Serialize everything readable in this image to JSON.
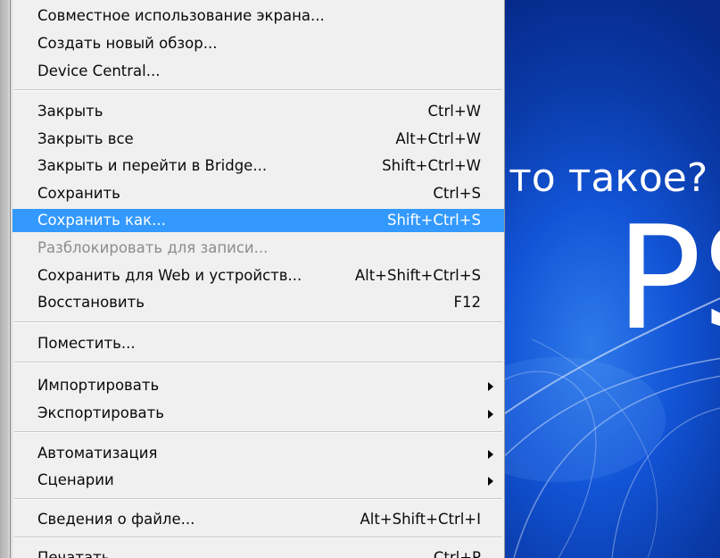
{
  "menu": {
    "items": [
      {
        "label": "Совместное использование экрана...",
        "shortcut": "",
        "submenu": false,
        "state": "normal"
      },
      {
        "label": "Создать новый обзор...",
        "shortcut": "",
        "submenu": false,
        "state": "normal"
      },
      {
        "label": "Device Central...",
        "shortcut": "",
        "submenu": false,
        "state": "normal"
      },
      {
        "label": "Закрыть",
        "shortcut": "Ctrl+W",
        "submenu": false,
        "state": "normal"
      },
      {
        "label": "Закрыть все",
        "shortcut": "Alt+Ctrl+W",
        "submenu": false,
        "state": "normal"
      },
      {
        "label": "Закрыть и перейти в Bridge...",
        "shortcut": "Shift+Ctrl+W",
        "submenu": false,
        "state": "normal"
      },
      {
        "label": "Сохранить",
        "shortcut": "Ctrl+S",
        "submenu": false,
        "state": "normal"
      },
      {
        "label": "Сохранить как...",
        "shortcut": "Shift+Ctrl+S",
        "submenu": false,
        "state": "highlighted"
      },
      {
        "label": "Разблокировать для записи...",
        "shortcut": "",
        "submenu": false,
        "state": "disabled"
      },
      {
        "label": "Сохранить для Web и устройств...",
        "shortcut": "Alt+Shift+Ctrl+S",
        "submenu": false,
        "state": "normal"
      },
      {
        "label": "Восстановить",
        "shortcut": "F12",
        "submenu": false,
        "state": "normal"
      },
      {
        "label": "Поместить...",
        "shortcut": "",
        "submenu": false,
        "state": "normal"
      },
      {
        "label": "Импортировать",
        "shortcut": "",
        "submenu": true,
        "state": "normal"
      },
      {
        "label": "Экспортировать",
        "shortcut": "",
        "submenu": true,
        "state": "normal"
      },
      {
        "label": "Автоматизация",
        "shortcut": "",
        "submenu": true,
        "state": "normal"
      },
      {
        "label": "Сценарии",
        "shortcut": "",
        "submenu": true,
        "state": "normal"
      },
      {
        "label": "Сведения о файле...",
        "shortcut": "Alt+Shift+Ctrl+I",
        "submenu": false,
        "state": "normal"
      },
      {
        "label": "Печатать...",
        "shortcut": "Ctrl+P",
        "submenu": false,
        "state": "normal"
      }
    ]
  },
  "canvas": {
    "question_text": "Что такое?",
    "logo_text": "PS",
    "colors": {
      "background": "#0a3aa8",
      "glow": "#2e7bea",
      "text": "#ffffff"
    }
  },
  "colors": {
    "menu_background": "#f0f0f0",
    "highlight": "#3399ff",
    "disabled_text": "#8d8d8d",
    "separator": "#c6c6c6"
  }
}
